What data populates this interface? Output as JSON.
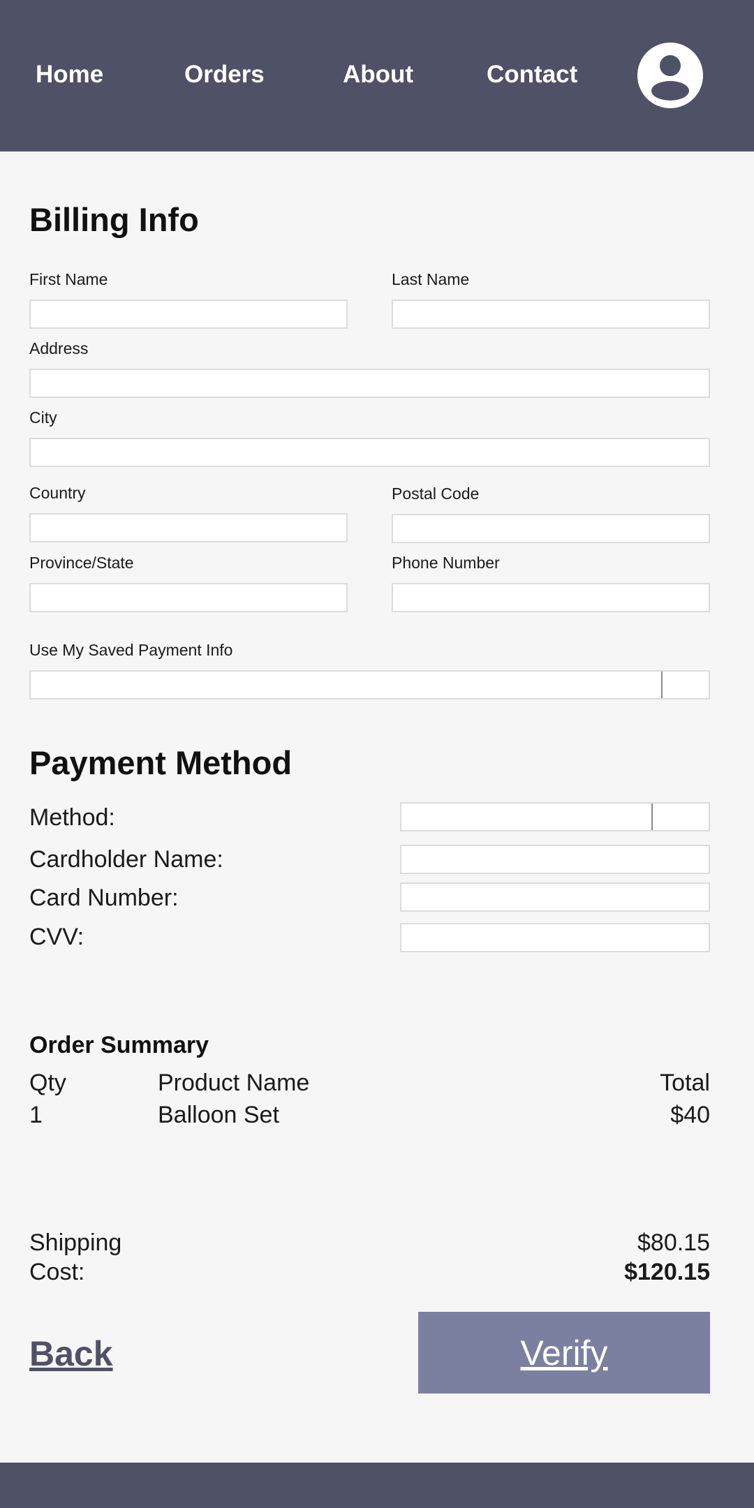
{
  "nav": {
    "items": [
      {
        "label": "Home"
      },
      {
        "label": "Orders"
      },
      {
        "label": "About"
      },
      {
        "label": "Contact"
      }
    ],
    "avatar_icon": "user-icon"
  },
  "billing": {
    "title": "Billing Info",
    "first_name_label": "First Name",
    "last_name_label": "Last Name",
    "address_label": "Address",
    "city_label": "City",
    "country_label": "Country",
    "postal_code_label": "Postal Code",
    "province_label": "Province/State",
    "phone_label": "Phone Number",
    "saved_payment_label": "Use My Saved Payment Info"
  },
  "payment": {
    "title": "Payment Method",
    "method_label": "Method:",
    "cardholder_label": "Cardholder Name:",
    "card_number_label": "Card Number:",
    "cvv_label": "CVV:"
  },
  "summary": {
    "title": "Order Summary",
    "headers": {
      "qty": "Qty",
      "product": "Product Name",
      "total": "Total"
    },
    "rows": [
      {
        "qty": "1",
        "product": "Balloon Set",
        "total": "$40"
      }
    ],
    "shipping_label": "Shipping",
    "shipping_value": "$80.15",
    "cost_label": "Cost:",
    "cost_value": "$120.15"
  },
  "actions": {
    "back_label": "Back",
    "verify_label": "Verify"
  },
  "colors": {
    "header_bg": "#4f5166",
    "button_bg": "#7b7fa0",
    "page_bg": "#f6f6f6"
  }
}
